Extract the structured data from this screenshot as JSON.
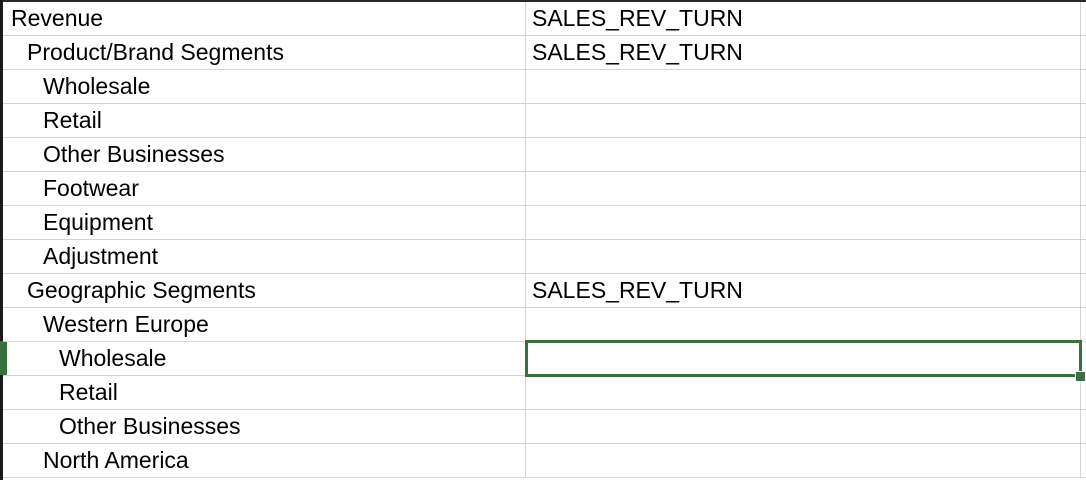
{
  "spreadsheet": {
    "rows": [
      {
        "label": "Revenue",
        "level": 0,
        "value": "SALES_REV_TURN"
      },
      {
        "label": "Product/Brand Segments",
        "level": 1,
        "value": "SALES_REV_TURN"
      },
      {
        "label": "Wholesale",
        "level": 2,
        "value": ""
      },
      {
        "label": "Retail",
        "level": 2,
        "value": ""
      },
      {
        "label": "Other Businesses",
        "level": 2,
        "value": ""
      },
      {
        "label": "Footwear",
        "level": 2,
        "value": ""
      },
      {
        "label": "Equipment",
        "level": 2,
        "value": ""
      },
      {
        "label": "Adjustment",
        "level": 2,
        "value": ""
      },
      {
        "label": "Geographic Segments",
        "level": 1,
        "value": "SALES_REV_TURN"
      },
      {
        "label": "Western Europe",
        "level": 2,
        "value": ""
      },
      {
        "label": "Wholesale",
        "level": 3,
        "value": ""
      },
      {
        "label": "Retail",
        "level": 3,
        "value": ""
      },
      {
        "label": "Other Businesses",
        "level": 3,
        "value": ""
      },
      {
        "label": "North America",
        "level": 2,
        "value": ""
      }
    ],
    "selected_row_index": 10,
    "accent_color": "#39703f",
    "gridline_color": "#d4d4d4"
  }
}
